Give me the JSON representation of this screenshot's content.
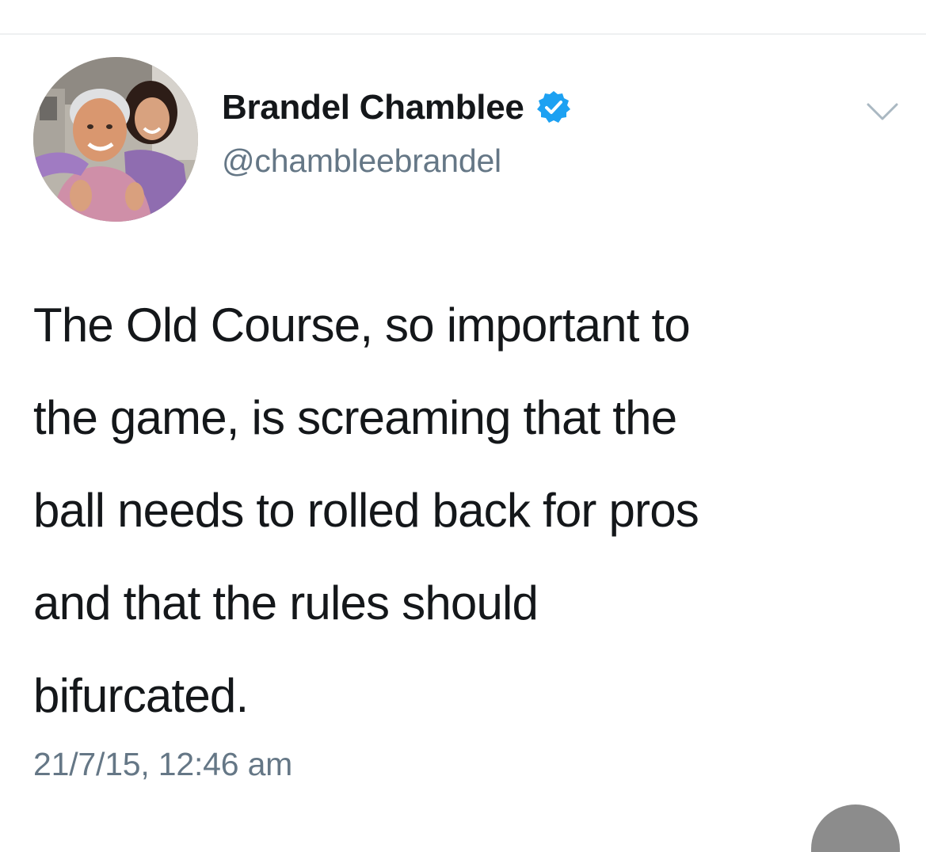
{
  "tweet": {
    "author": {
      "display_name": "Brandel Chamblee",
      "handle": "@chambleebrandel",
      "verified": true,
      "avatar": "profile-photo"
    },
    "text": "The Old Course, so important to\nthe game, is screaming that the\nball needs to rolled back for pros\nand that the rules should\nbifurcated.",
    "timestamp": "21/7/15, 12:46 am"
  },
  "icons": {
    "verified": "verified-badge-icon",
    "menu": "chevron-down-icon"
  },
  "colors": {
    "verified_blue": "#1da1f2",
    "secondary_text": "#657786",
    "primary_text": "#14171a"
  }
}
